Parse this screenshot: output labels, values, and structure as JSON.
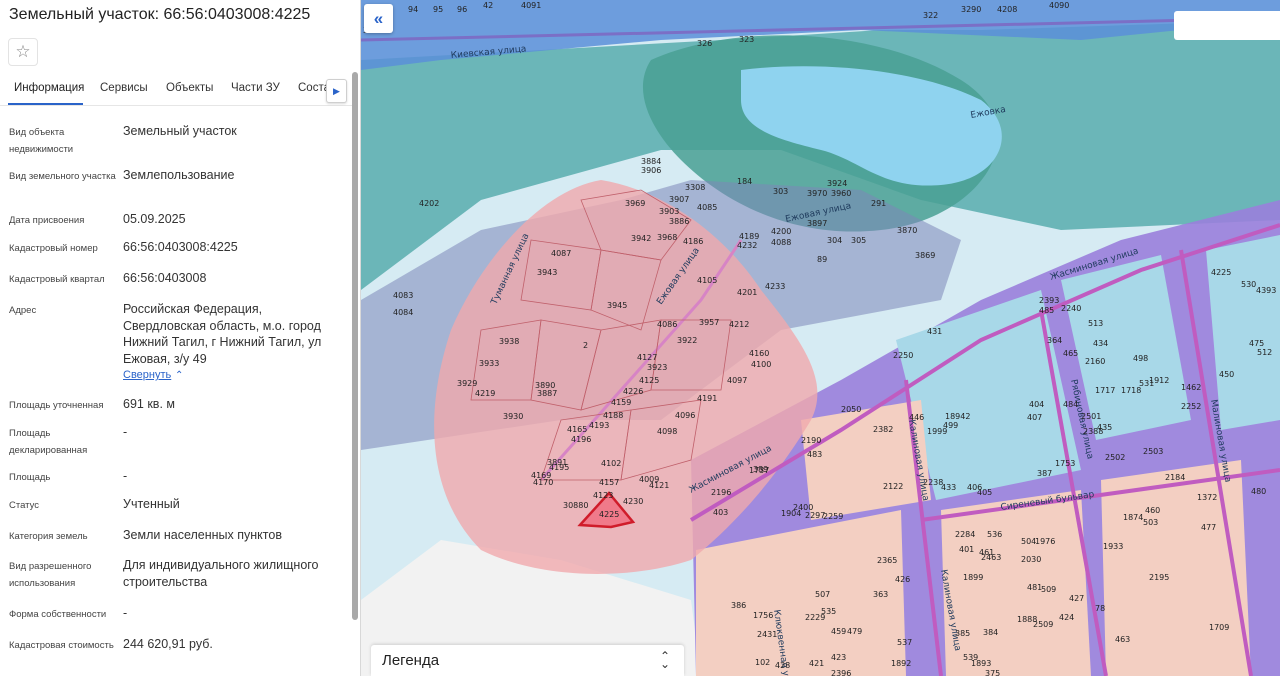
{
  "panel": {
    "title": "Земельный участок: 66:56:0403008:4225",
    "tabs": [
      "Информация",
      "Сервисы",
      "Объекты",
      "Части ЗУ",
      "Соста"
    ],
    "collapse_link": "Свернуть",
    "rows": [
      {
        "label": "Вид объекта недвижимости",
        "value": "Земельный участок"
      },
      {
        "label": "Вид земельного участка",
        "value": "Землепользование"
      },
      {
        "label": "Дата присвоения",
        "value": "05.09.2025"
      },
      {
        "label": "Кадастровый номер",
        "value": "66:56:0403008:4225"
      },
      {
        "label": "Кадастровый квартал",
        "value": "66:56:0403008"
      },
      {
        "label": "Адрес",
        "value": "Российская Федерация, Свердловская область, м.о. город Нижний Тагил, г Нижний Тагил, ул Ежовая, з/у 49"
      },
      {
        "label": "Площадь уточненная",
        "value": "691 кв. м"
      },
      {
        "label": "Площадь декларированная",
        "value": "-"
      },
      {
        "label": "Площадь",
        "value": "-"
      },
      {
        "label": "Статус",
        "value": "Учтенный"
      },
      {
        "label": "Категория земель",
        "value": "Земли населенных пунктов"
      },
      {
        "label": "Вид разрешенного использования",
        "value": "Для индивидуального жилищного строительства"
      },
      {
        "label": "Форма собственности",
        "value": "-"
      },
      {
        "label": "Кадастровая стоимость",
        "value": "244 620,91 руб."
      }
    ]
  },
  "map": {
    "legend_label": "Легенда",
    "selected_parcel": "4225",
    "streets": [
      "Киевская улица",
      "Ежовая улица",
      "Туманная улица",
      "Жасминовая улица",
      "Сиреневый бульвар",
      "Калиновая улица",
      "Рябиновая улица",
      "Малиновая улица",
      "Клюквенная улица",
      "Ежовка"
    ],
    "parcel_numbers": [
      "324",
      "94",
      "95",
      "96",
      "42",
      "4091",
      "322",
      "3290",
      "4208",
      "4090",
      "326",
      "323",
      "4202",
      "3884",
      "3906",
      "3308",
      "184",
      "303",
      "3970",
      "3924",
      "3960",
      "3907",
      "3903",
      "3886",
      "4085",
      "3969",
      "3942",
      "3968",
      "4186",
      "4189",
      "4232",
      "4200",
      "4088",
      "3897",
      "304",
      "305",
      "291",
      "3870",
      "3869",
      "89",
      "4087",
      "3943",
      "4105",
      "4201",
      "4233",
      "3945",
      "4086",
      "3957",
      "4212",
      "3922",
      "4160",
      "4100",
      "4083",
      "4084",
      "3938",
      "3933",
      "3929",
      "4219",
      "3890",
      "3887",
      "3930",
      "2",
      "4127",
      "3923",
      "4125",
      "4226",
      "4159",
      "4097",
      "4191",
      "4188",
      "4096",
      "4165",
      "4196",
      "4193",
      "4098",
      "3891",
      "4195",
      "4169",
      "4170",
      "4102",
      "4157",
      "4009",
      "4121",
      "4123",
      "4230",
      "30880",
      "4225",
      "530",
      "4393",
      "2393",
      "2240",
      "485",
      "513",
      "475",
      "512",
      "2250",
      "431",
      "364",
      "434",
      "2160",
      "465",
      "498",
      "1912",
      "1462",
      "450",
      "2252",
      "446",
      "2050",
      "531",
      "1718",
      "1717",
      "484",
      "404",
      "18942",
      "435",
      "2501",
      "407",
      "2388",
      "2382",
      "1999",
      "499",
      "2190",
      "483",
      "2502",
      "2503",
      "1753",
      "387",
      "2184",
      "2122",
      "1737",
      "2238",
      "433",
      "406",
      "405",
      "2196",
      "403",
      "389",
      "1904",
      "2400",
      "2297",
      "2259",
      "460",
      "503",
      "1874",
      "1372",
      "477",
      "1933",
      "480",
      "2284",
      "461",
      "536",
      "504",
      "1976",
      "1899",
      "2195",
      "2463",
      "401",
      "2030",
      "481",
      "509",
      "424",
      "1888",
      "507",
      "535",
      "2365",
      "426",
      "363",
      "2509",
      "78",
      "427",
      "1709",
      "385",
      "384",
      "539",
      "1893",
      "537",
      "459",
      "2229",
      "479",
      "463",
      "386",
      "1756",
      "2431",
      "102",
      "428",
      "421",
      "1892",
      "423",
      "2396",
      "375"
    ]
  }
}
